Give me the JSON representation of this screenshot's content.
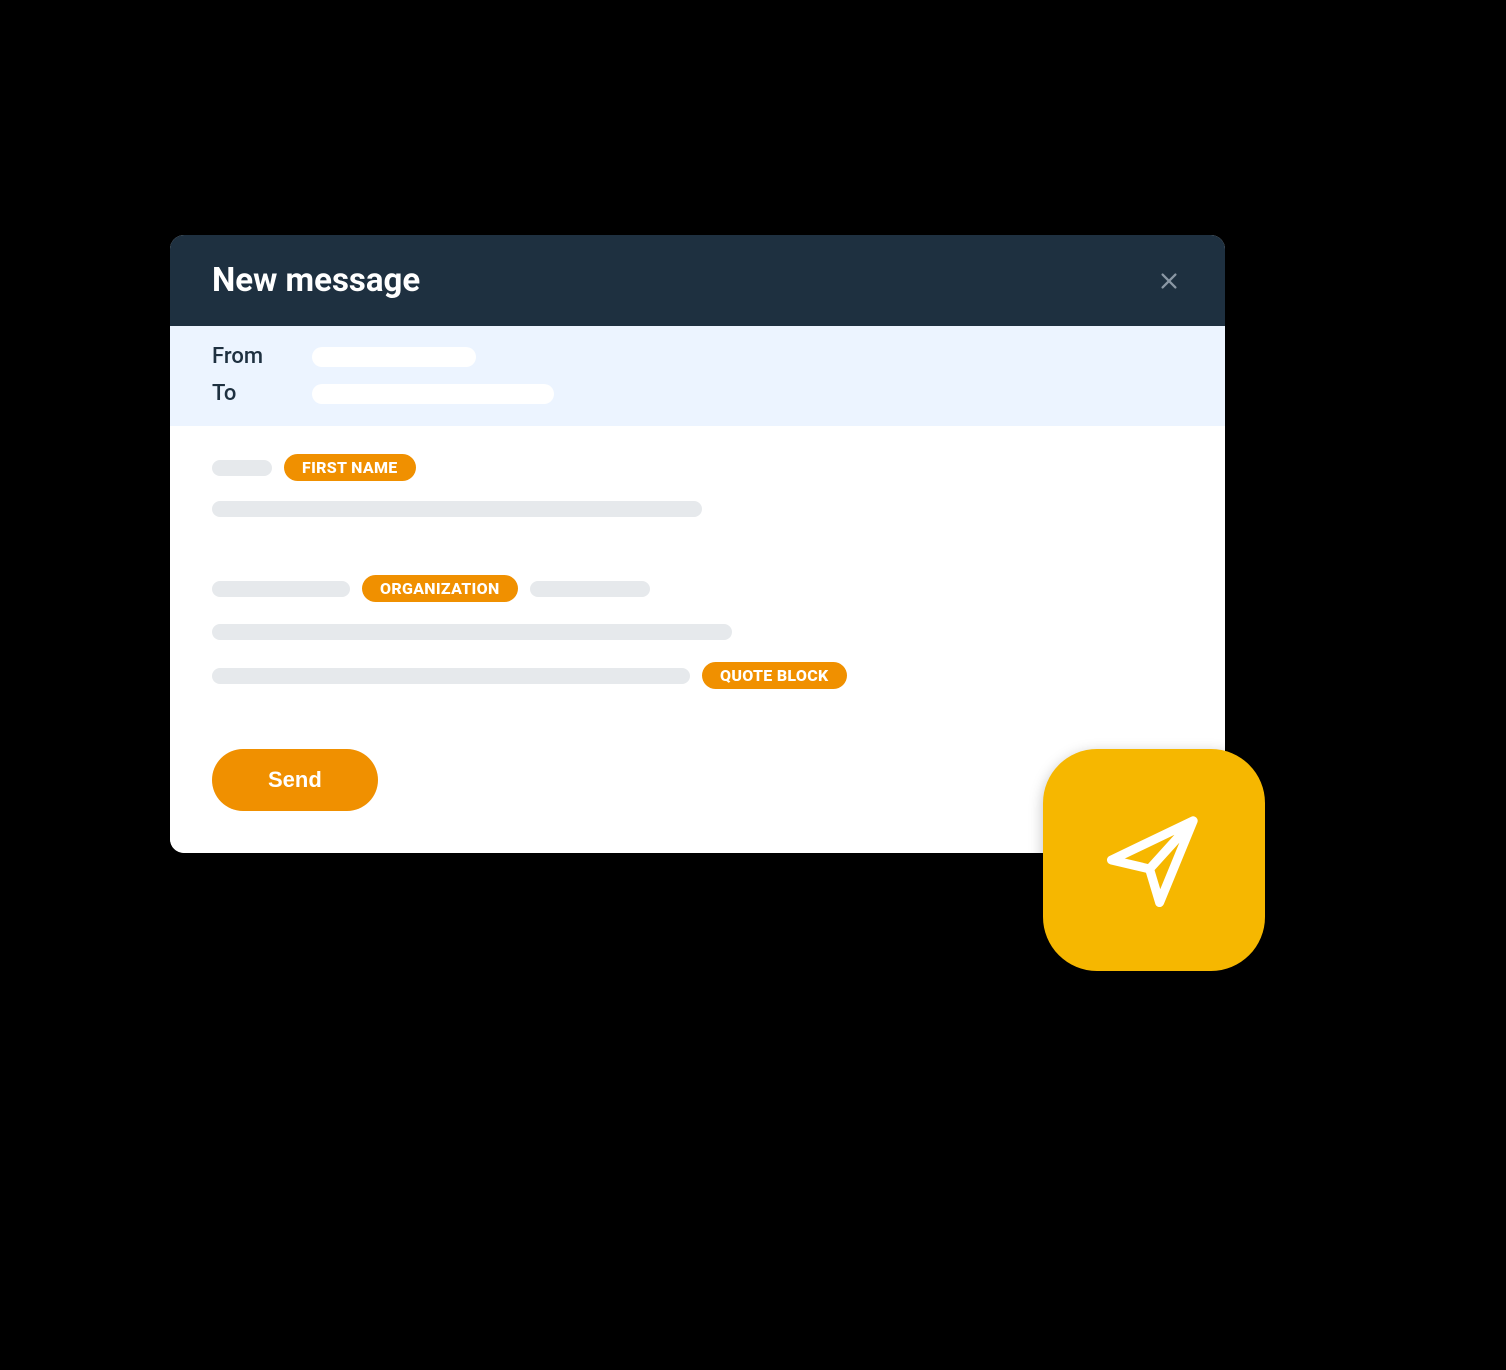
{
  "header": {
    "title": "New message"
  },
  "address": {
    "from_label": "From",
    "to_label": "To"
  },
  "chips": {
    "first_name": "FIRST NAME",
    "organization": "ORGANIZATION",
    "quote_block": "QUOTE BLOCK"
  },
  "actions": {
    "send": "Send"
  },
  "colors": {
    "header_bg": "#1e3040",
    "addr_bg": "#ecf4ff",
    "placeholder": "#e6e9ec",
    "accent": "#f09000",
    "fab": "#f6b700"
  }
}
